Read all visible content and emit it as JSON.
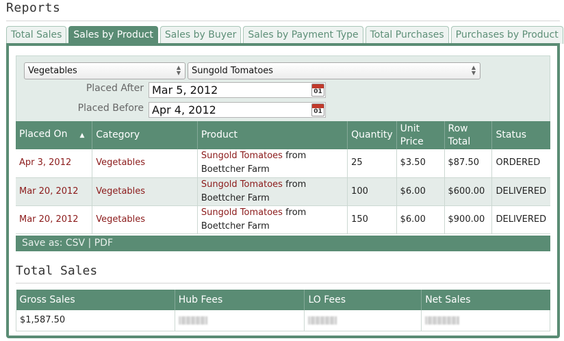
{
  "page": {
    "title": "Reports"
  },
  "tabs": [
    {
      "label": "Total Sales",
      "active": false
    },
    {
      "label": "Sales by Product",
      "active": true
    },
    {
      "label": "Sales by Buyer",
      "active": false
    },
    {
      "label": "Sales by Payment Type",
      "active": false
    },
    {
      "label": "Total Purchases",
      "active": false
    },
    {
      "label": "Purchases by Product",
      "active": false
    }
  ],
  "filters": {
    "category_select": "Vegetables",
    "product_select": "Sungold Tomatoes",
    "placed_after_label": "Placed After",
    "placed_after_value": "Mar 5, 2012",
    "placed_before_label": "Placed Before",
    "placed_before_value": "Apr 4, 2012",
    "calendar_icon_text": "01"
  },
  "orders_table": {
    "columns": [
      "Placed On",
      "Category",
      "Product",
      "Quantity",
      "Unit Price",
      "Row Total",
      "Status"
    ],
    "sort_indicator": "▲",
    "rows": [
      {
        "placed_on": "Apr 3, 2012",
        "category": "Vegetables",
        "product": "Sungold Tomatoes",
        "product_suffix": " from Boettcher Farm",
        "quantity": "25",
        "unit_price": "$3.50",
        "row_total": "$87.50",
        "status": "ORDERED"
      },
      {
        "placed_on": "Mar 20, 2012",
        "category": "Vegetables",
        "product": "Sungold Tomatoes",
        "product_suffix": " from Boettcher Farm",
        "quantity": "100",
        "unit_price": "$6.00",
        "row_total": "$600.00",
        "status": "DELIVERED"
      },
      {
        "placed_on": "Mar 20, 2012",
        "category": "Vegetables",
        "product": "Sungold Tomatoes",
        "product_suffix": " from Boettcher Farm",
        "quantity": "150",
        "unit_price": "$6.00",
        "row_total": "$900.00",
        "status": "DELIVERED"
      }
    ]
  },
  "save_bar": {
    "prefix": "Save as: ",
    "csv": "CSV",
    "separator": " | ",
    "pdf": "PDF"
  },
  "totals": {
    "title": "Total Sales",
    "columns": [
      "Gross Sales",
      "Hub Fees",
      "LO Fees",
      "Net Sales"
    ],
    "gross_sales": "$1,587.50"
  },
  "colors": {
    "accent": "#5a8c74",
    "link": "#8b1a1a",
    "alt_row": "#e5ece9",
    "filter_bg": "#e3ece8"
  }
}
